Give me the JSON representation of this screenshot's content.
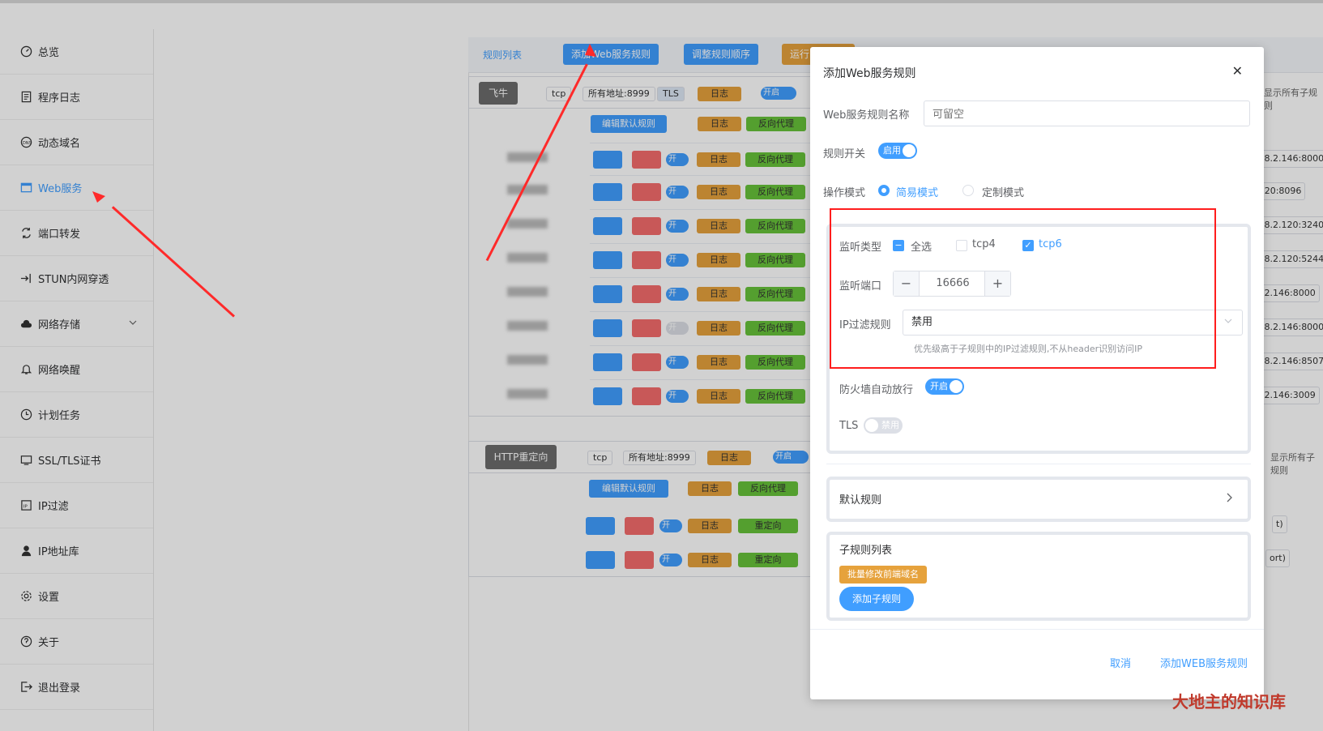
{
  "sidebar": {
    "items": [
      {
        "label": "总览",
        "icon": "dashboard-icon"
      },
      {
        "label": "程序日志",
        "icon": "log-icon"
      },
      {
        "label": "动态域名",
        "icon": "dns-icon"
      },
      {
        "label": "Web服务",
        "icon": "web-icon",
        "active": true
      },
      {
        "label": "端口转发",
        "icon": "port-forward-icon"
      },
      {
        "label": "STUN内网穿透",
        "icon": "stun-icon"
      },
      {
        "label": "网络存储",
        "icon": "cloud-icon",
        "has_children": true
      },
      {
        "label": "网络唤醒",
        "icon": "bell-icon"
      },
      {
        "label": "计划任务",
        "icon": "clock-icon"
      },
      {
        "label": "SSL/TLS证书",
        "icon": "certificate-icon"
      },
      {
        "label": "IP过滤",
        "icon": "ip-filter-icon"
      },
      {
        "label": "IP地址库",
        "icon": "ip-database-icon"
      },
      {
        "label": "设置",
        "icon": "gear-icon"
      },
      {
        "label": "关于",
        "icon": "about-icon"
      },
      {
        "label": "退出登录",
        "icon": "logout-icon"
      }
    ]
  },
  "tabs": {
    "rule_list": "规则列表",
    "add_web_rule": "添加Web服务规则",
    "adjust_order": "调整规则顺序",
    "run": "运行"
  },
  "bg": {
    "group1_name": "飞牛",
    "group1_proto": "tcp",
    "group1_addr": "所有地址:8999",
    "group1_tls": "TLS",
    "log": "日志",
    "on": "开启",
    "show_all_children": "显示所有子规则",
    "edit_default": "编辑默认规则",
    "reverse_proxy": "反向代理",
    "switch_on_short": "开",
    "ips": [
      ".8.2.146:8000",
      ":20:8096",
      ".8.2.120:32400",
      ".8.2.120:5244",
      ".2.146:8000",
      ".8.2.146:8000",
      ".8.2.146:8507",
      ".2.146:3009"
    ],
    "group2_name": "HTTP重定向",
    "group2_proto": "tcp",
    "group2_addr": "所有地址:8999",
    "redirect": "重定向",
    "suffixes": [
      "t)",
      "ort)"
    ]
  },
  "modal": {
    "title": "添加Web服务规则",
    "name_label": "Web服务规则名称",
    "name_placeholder": "可留空",
    "switch_label": "规则开关",
    "switch_text": "启用",
    "mode_label": "操作模式",
    "mode_simple": "简易模式",
    "mode_custom": "定制模式",
    "listen_type_label": "监听类型",
    "select_all": "全选",
    "tcp4": "tcp4",
    "tcp6": "tcp6",
    "listen_port_label": "监听端口",
    "listen_port": "16666",
    "ip_filter_label": "IP过滤规则",
    "ip_filter_value": "禁用",
    "ip_filter_hint": "优先级高于子规则中的IP过滤规则,不从header识别访问IP",
    "firewall_label": "防火墙自动放行",
    "firewall_text": "开启",
    "tls_label": "TLS",
    "tls_text": "禁用",
    "default_rule": "默认规则",
    "sub_rules_title": "子规则列表",
    "batch_modify": "批量修改前端域名",
    "add_sub_rule": "添加子规则",
    "cancel": "取消",
    "confirm": "添加WEB服务规则"
  },
  "watermark": "大地主的知识库",
  "colors": {
    "primary": "#409eff",
    "danger": "#f56c6c",
    "warning": "#e6a23c",
    "success": "#67c23a",
    "annotation": "#ff2a2a"
  }
}
